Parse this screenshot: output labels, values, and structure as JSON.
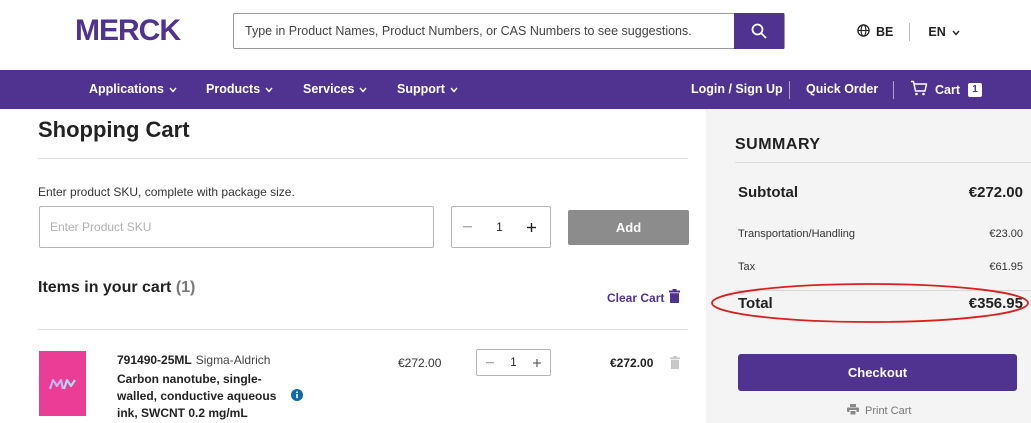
{
  "header": {
    "brand": "MERCK",
    "search_placeholder": "Type in Product Names, Product Numbers, or CAS Numbers to see suggestions.",
    "region": "BE",
    "language": "EN"
  },
  "nav": {
    "items": [
      {
        "label": "Applications"
      },
      {
        "label": "Products"
      },
      {
        "label": "Services"
      },
      {
        "label": "Support"
      }
    ],
    "login": "Login / Sign Up",
    "quick_order": "Quick Order",
    "cart_label": "Cart",
    "cart_count": "1"
  },
  "cart": {
    "title": "Shopping Cart",
    "sku_instruction": "Enter product SKU, complete with package size.",
    "sku_placeholder": "Enter Product SKU",
    "quantity": "1",
    "add_label": "Add",
    "items_title": "Items in your cart",
    "items_count": "(1)",
    "clear_label": "Clear Cart",
    "items": [
      {
        "sku": "791490-25ML",
        "brand": "Sigma-Aldrich",
        "description": "Carbon nanotube, single-walled, conductive aqueous ink, SWCNT 0.2 mg/mL",
        "price": "€272.00",
        "quantity": "1",
        "total": "€272.00"
      }
    ]
  },
  "summary": {
    "title": "SUMMARY",
    "subtotal_label": "Subtotal",
    "subtotal": "€272.00",
    "shipping_label": "Transportation/Handling",
    "shipping": "€23.00",
    "tax_label": "Tax",
    "tax": "€61.95",
    "total_label": "Total",
    "total": "€356.95",
    "checkout_label": "Checkout",
    "print_label": "Print Cart"
  },
  "colors": {
    "brand_purple": "#503291",
    "brand_pink": "#eb3c96",
    "annotation_red": "#d92020",
    "disabled_gray": "#8c8c8c"
  },
  "annotation": {
    "type": "red-ellipse",
    "target": "summary-total-row"
  }
}
